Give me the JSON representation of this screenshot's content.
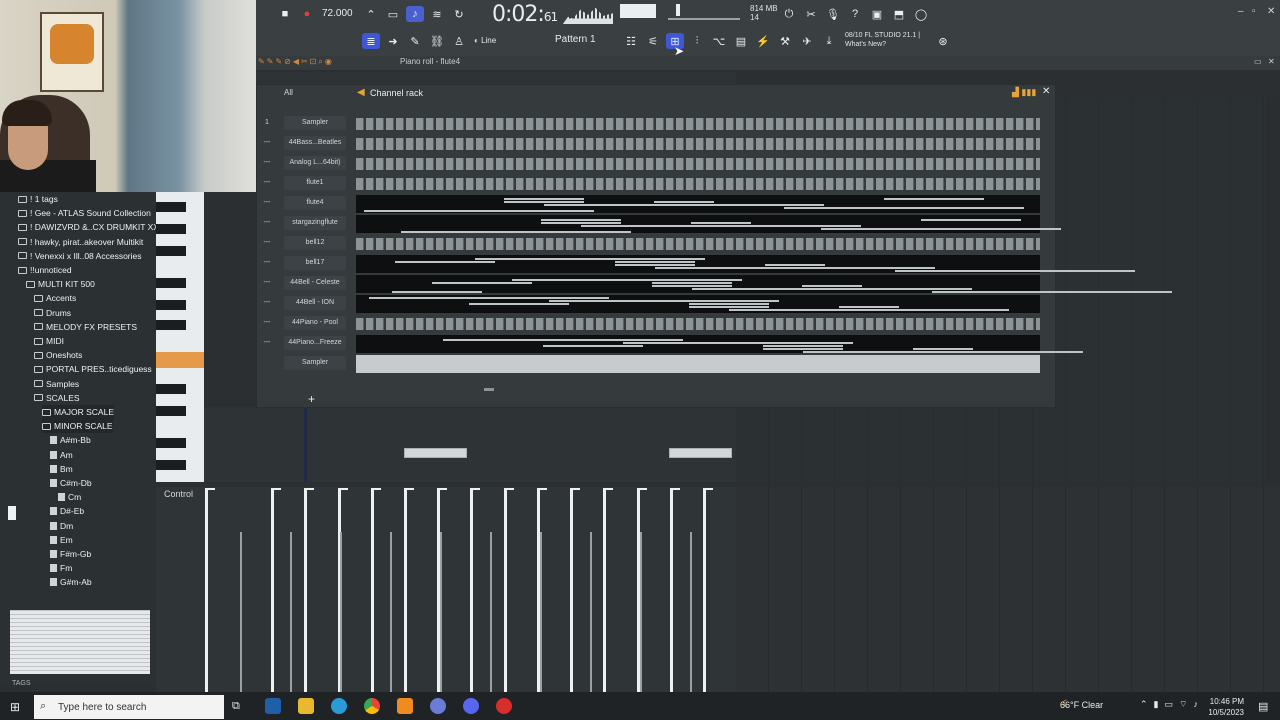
{
  "transport": {
    "tempo": "72.000",
    "time_main": "0:02:",
    "time_frac": "61",
    "memory": "814 MB",
    "voices": "14",
    "pattern": "Pattern 1",
    "snap": "Line",
    "fl_version_line1": "08/10  FL STUDIO 21.1 |",
    "fl_version_line2": "What's New?"
  },
  "piano_roll": {
    "title": "Piano roll - flute4",
    "control_label": "Control"
  },
  "channel_rack": {
    "title": "Channel rack",
    "filter": "All",
    "channels": [
      {
        "num": "1",
        "name": "Sampler",
        "mode": "steps"
      },
      {
        "num": "---",
        "name": "44Bass...Beatles",
        "mode": "steps"
      },
      {
        "num": "---",
        "name": "Analog L...64bit)",
        "mode": "steps"
      },
      {
        "num": "---",
        "name": "flute1",
        "mode": "steps"
      },
      {
        "num": "---",
        "name": "flute4",
        "mode": "roll"
      },
      {
        "num": "---",
        "name": "stargazingflute",
        "mode": "roll"
      },
      {
        "num": "---",
        "name": "bell12",
        "mode": "steps"
      },
      {
        "num": "---",
        "name": "bell17",
        "mode": "roll"
      },
      {
        "num": "---",
        "name": "44Bell - Celeste",
        "mode": "roll"
      },
      {
        "num": "---",
        "name": "44Bell - ION",
        "mode": "roll"
      },
      {
        "num": "---",
        "name": "44Piano - Pool",
        "mode": "steps"
      },
      {
        "num": "---",
        "name": "44Piano...Freeze",
        "mode": "roll"
      },
      {
        "num": "",
        "name": "Sampler",
        "mode": "sampler"
      }
    ]
  },
  "browser": {
    "items": [
      {
        "label": "! 1 tags",
        "type": "folder",
        "indent": 1
      },
      {
        "label": "! Gee - ATLAS Sound Collection",
        "type": "folder",
        "indent": 1
      },
      {
        "label": "! DAWIZVRD &..CX DRUMKIT XXL",
        "type": "folder",
        "indent": 1
      },
      {
        "label": "! hawky, pirat..akeover Multikit",
        "type": "folder",
        "indent": 1
      },
      {
        "label": "! Venexxi x Ill..08 Accessories",
        "type": "folder",
        "indent": 1
      },
      {
        "label": "!!unnoticed",
        "type": "folder",
        "indent": 1
      },
      {
        "label": "MULTI KIT 500",
        "type": "folder",
        "indent": 2
      },
      {
        "label": "Accents",
        "type": "folder",
        "indent": 3
      },
      {
        "label": "Drums",
        "type": "folder",
        "indent": 3
      },
      {
        "label": "MELODY FX PRESETS",
        "type": "folder",
        "indent": 3
      },
      {
        "label": "MIDI",
        "type": "folder",
        "indent": 3
      },
      {
        "label": "Oneshots",
        "type": "folder",
        "indent": 3
      },
      {
        "label": "PORTAL PRES..ticediguess",
        "type": "folder",
        "indent": 3
      },
      {
        "label": "Samples",
        "type": "folder",
        "indent": 3
      },
      {
        "label": "SCALES",
        "type": "folder",
        "indent": 3
      },
      {
        "label": "MAJOR SCALE",
        "type": "folder",
        "indent": 4
      },
      {
        "label": "MINOR SCALE",
        "type": "folder",
        "indent": 4
      },
      {
        "label": "A#m-Bb",
        "type": "file",
        "indent": 5
      },
      {
        "label": "Am",
        "type": "file",
        "indent": 5
      },
      {
        "label": "Bm",
        "type": "file",
        "indent": 5
      },
      {
        "label": "C#m-Db",
        "type": "file",
        "indent": 5
      },
      {
        "label": "Cm",
        "type": "file",
        "indent": 6
      },
      {
        "label": "D#-Eb",
        "type": "file",
        "indent": 5
      },
      {
        "label": "Dm",
        "type": "file",
        "indent": 5
      },
      {
        "label": "Em",
        "type": "file",
        "indent": 5
      },
      {
        "label": "F#m-Gb",
        "type": "file",
        "indent": 5
      },
      {
        "label": "Fm",
        "type": "file",
        "indent": 5
      },
      {
        "label": "G#m-Ab",
        "type": "file",
        "indent": 5
      }
    ],
    "tags_label": "TAGS"
  },
  "taskbar": {
    "search_placeholder": "Type here to search",
    "weather": "66°F  Clear",
    "time": "10:46 PM",
    "date": "10/5/2023"
  }
}
